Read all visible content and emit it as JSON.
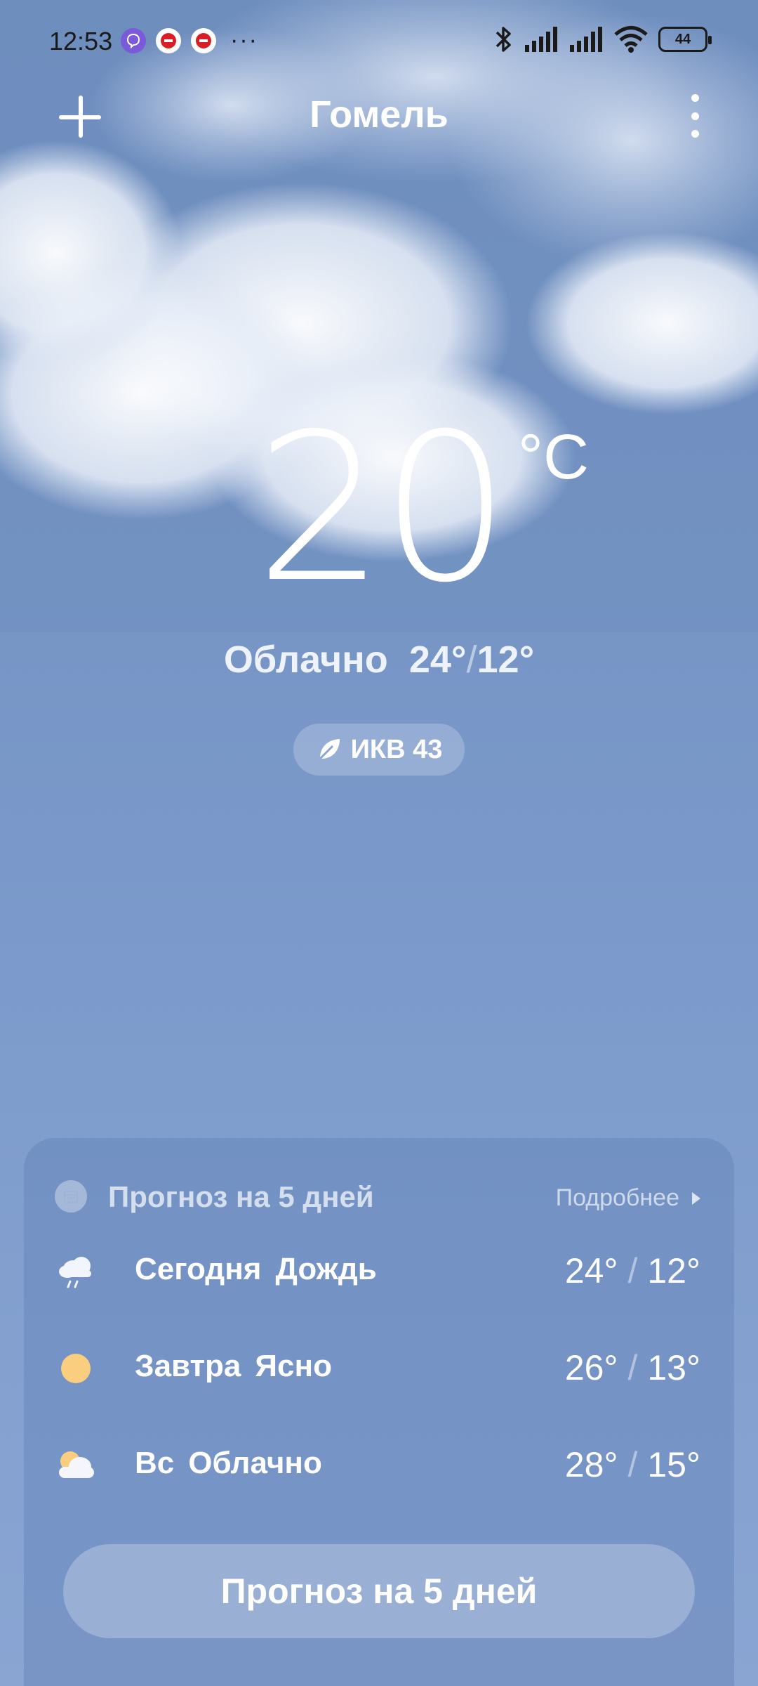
{
  "status_bar": {
    "time": "12:53",
    "battery": "44"
  },
  "header": {
    "city": "Гомель"
  },
  "current": {
    "temperature": "20",
    "unit": "°C",
    "condition": "Облачно",
    "high": "24°",
    "low": "12°",
    "aqi_label": "ИКВ 43"
  },
  "forecast": {
    "title": "Прогноз на 5 дней",
    "more_label": "Подробнее",
    "days": [
      {
        "day": "Сегодня",
        "condition": "Дождь",
        "high": "24°",
        "low": "12°",
        "icon": "rain-icon"
      },
      {
        "day": "Завтра",
        "condition": "Ясно",
        "high": "26°",
        "low": "13°",
        "icon": "sun-icon"
      },
      {
        "day": "Вс",
        "condition": "Облачно",
        "high": "28°",
        "low": "15°",
        "icon": "partly-cloudy-icon"
      }
    ],
    "button_label": "Прогноз на 5 дней"
  },
  "colors": {
    "sky": "#7594c4",
    "sun": "#f9cf7f"
  }
}
